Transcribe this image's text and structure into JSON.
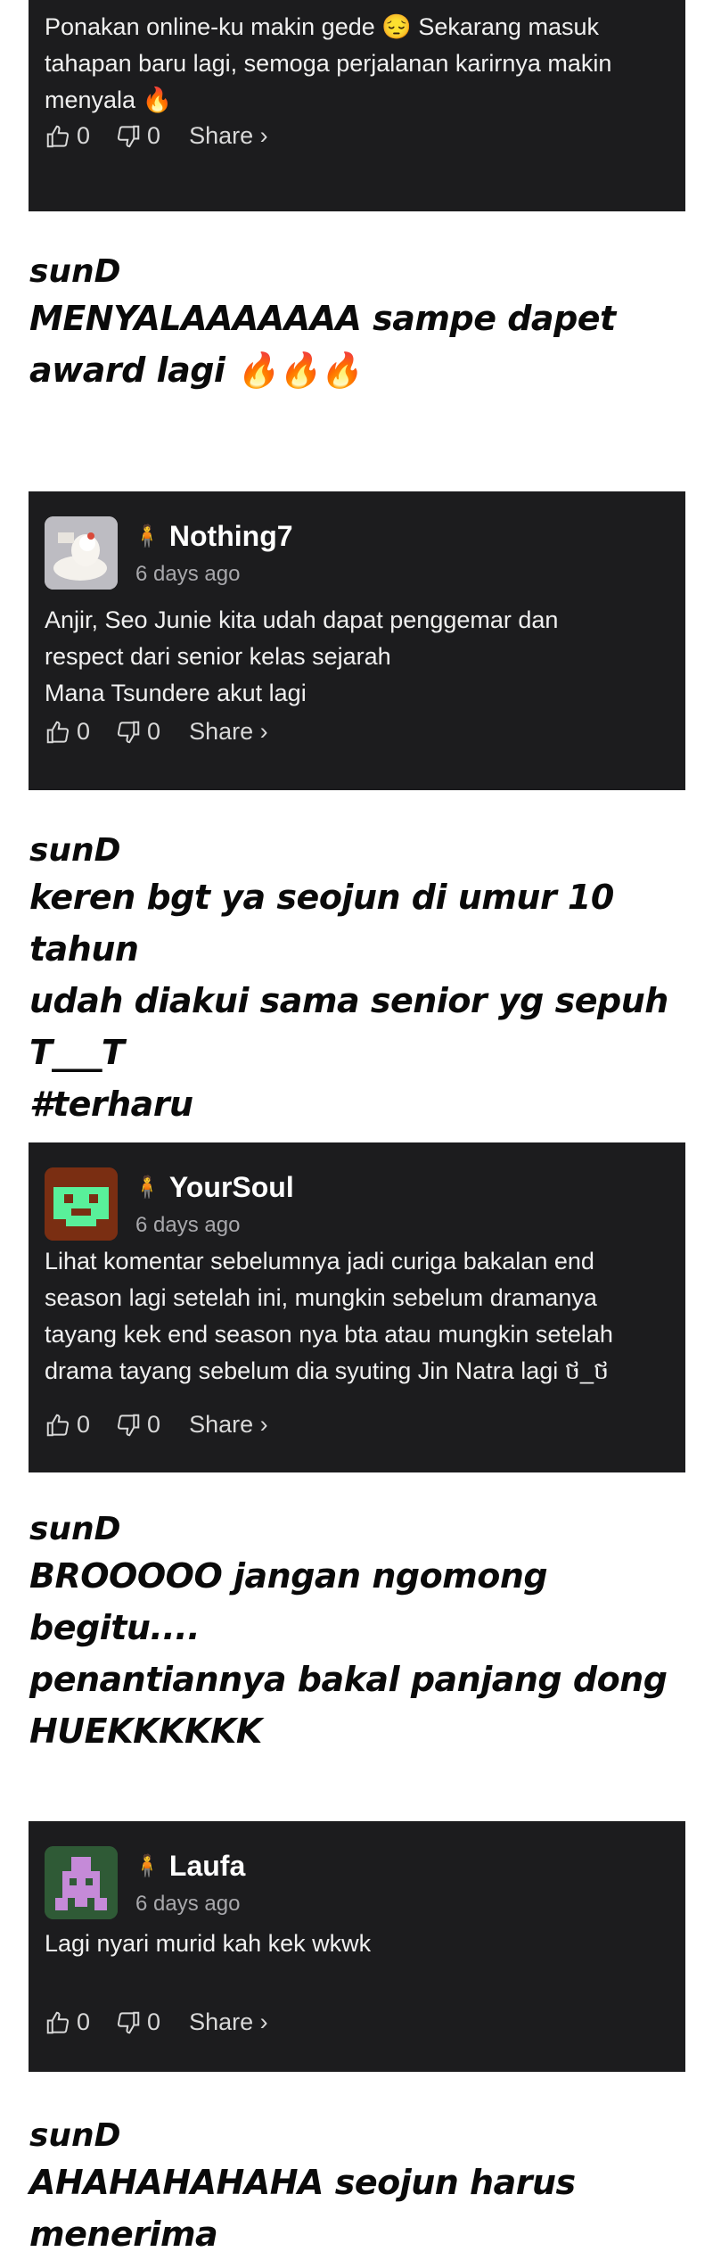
{
  "comments": [
    {
      "username": "",
      "time": "",
      "text": "Ponakan online-ku makin gede 😔 Sekarang masuk tahapan baru lagi, semoga perjalanan karirnya makin menyala 🔥",
      "likes": "0",
      "dislikes": "0",
      "share": "Share ›"
    },
    {
      "username": "Nothing7",
      "time": "6 days ago",
      "text_lines": [
        "Anjir, Seo Junie kita udah dapat penggemar dan",
        "respect dari senior kelas sejarah",
        "Mana Tsundere akut lagi"
      ],
      "likes": "0",
      "dislikes": "0",
      "share": "Share ›"
    },
    {
      "username": "YourSoul",
      "time": "6 days ago",
      "text": "Lihat komentar sebelumnya jadi curiga bakalan end season lagi setelah ini, mungkin sebelum dramanya tayang kek end season nya bta atau mungkin setelah drama tayang sebelum dia syuting Jin Natra lagi ថ_ថ",
      "likes": "0",
      "dislikes": "0",
      "share": "Share ›"
    },
    {
      "username": "Laufa",
      "time": "6 days ago",
      "text": "Lagi nyari murid kah kek wkwk",
      "likes": "0",
      "dislikes": "0",
      "share": "Share ›"
    }
  ],
  "replies": [
    {
      "author": "sunD",
      "lines": [
        "MENYALAAAAAAA sampe dapet",
        " award lagi 🔥🔥🔥"
      ]
    },
    {
      "author": "sunD",
      "lines": [
        "keren bgt ya seojun di umur 10 tahun",
        "udah diakui sama senior yg sepuh T___T",
        "#terharu"
      ]
    },
    {
      "author": "sunD",
      "lines": [
        "BROOOOO jangan ngomong begitu....",
        "penantiannya bakal panjang dong",
        "HUEKKKKKK"
      ]
    },
    {
      "author": "sunD",
      "lines": [
        "AHAHAHAHAHA seojun harus menerima"
      ]
    }
  ],
  "badge_icon": "person-icon",
  "colors": {
    "card_bg": "#1c1c1e",
    "page_bg": "#ffffff",
    "muted": "#a8a8ac"
  }
}
